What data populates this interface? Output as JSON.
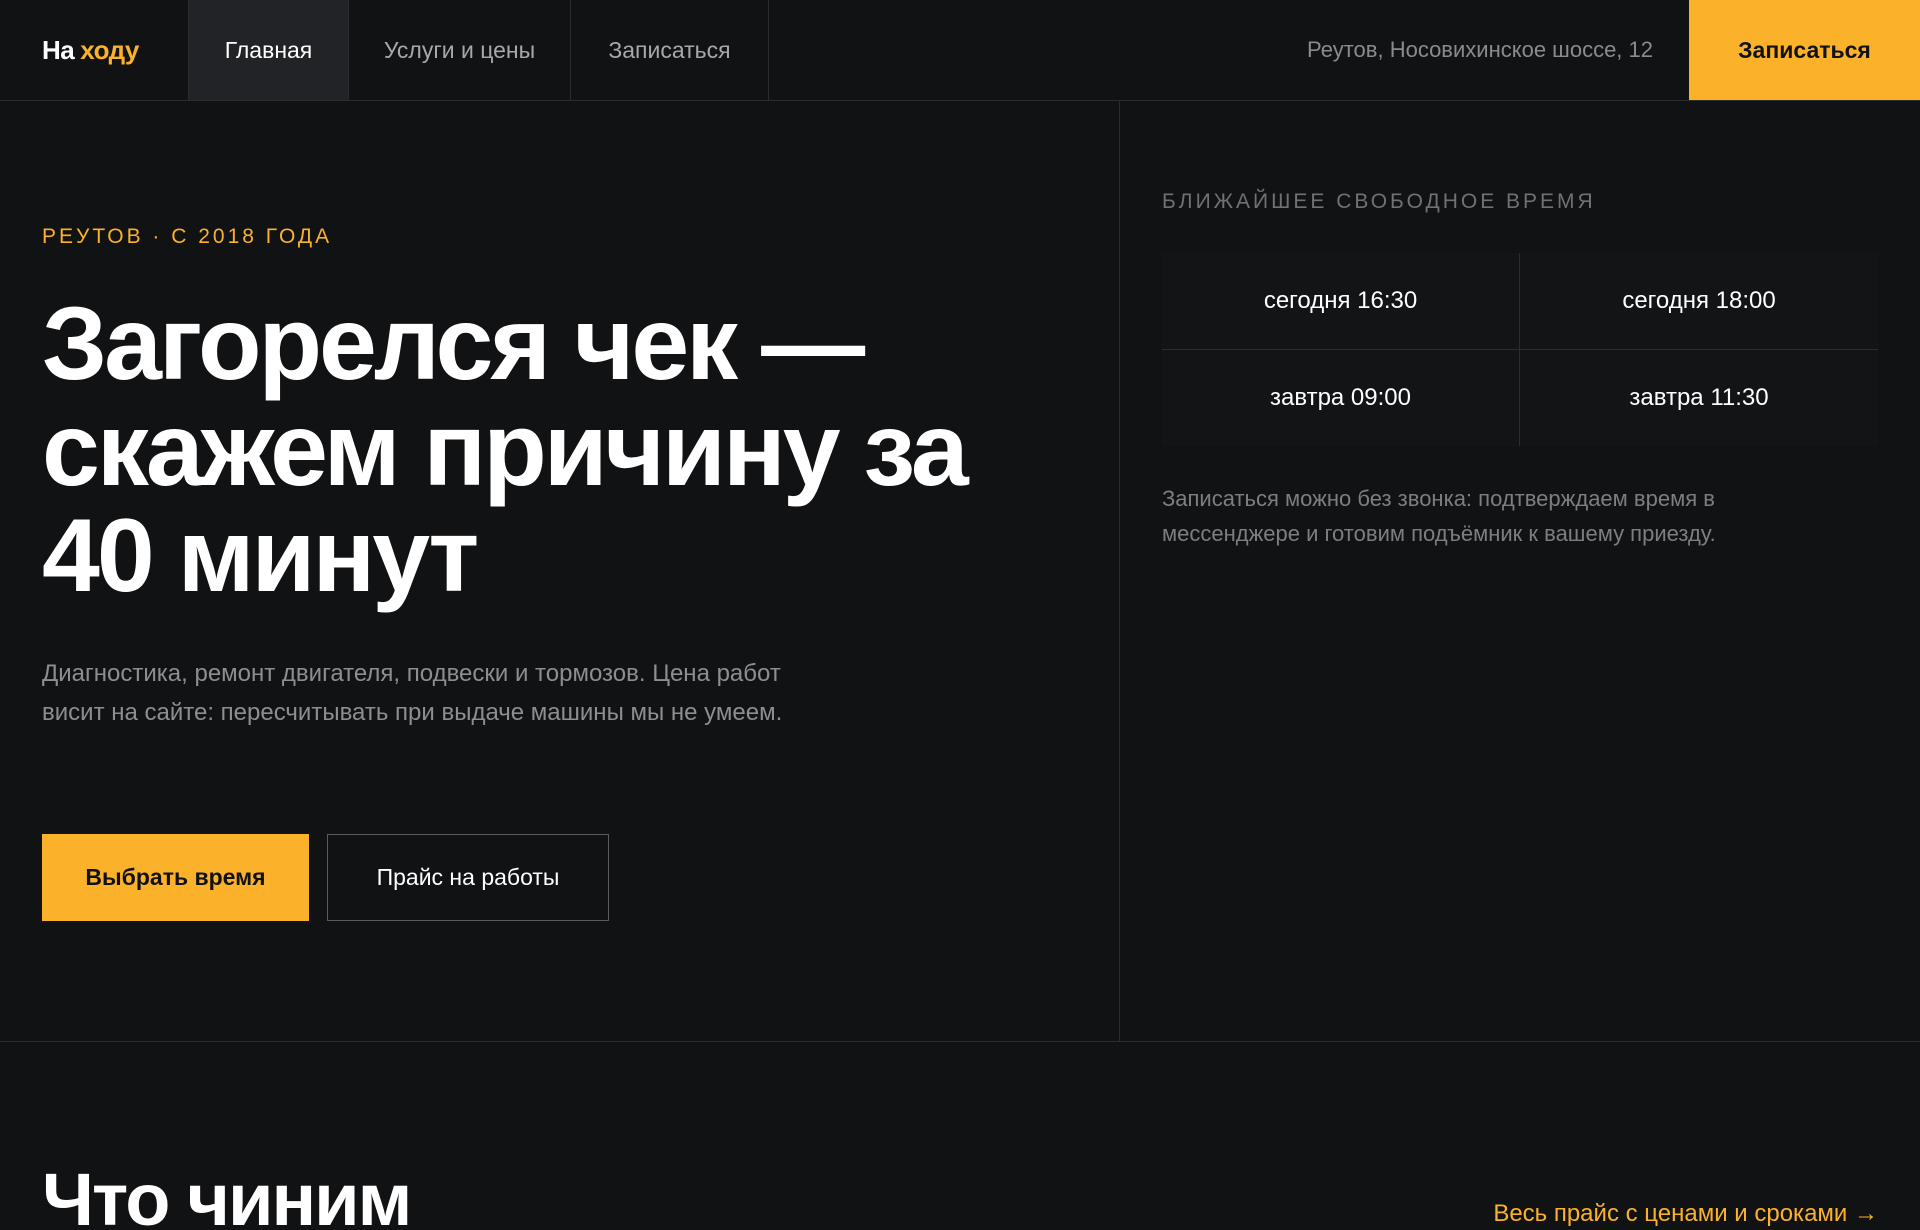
{
  "header": {
    "logo_main": "На",
    "logo_accent": "ходу",
    "nav": [
      "Главная",
      "Услуги и цены",
      "Записаться"
    ],
    "address": "Реутов, Носовихинское шоссе, 12",
    "cta": "Записаться"
  },
  "hero": {
    "eyebrow": "РЕУТОВ · С 2018 ГОДА",
    "headline": "Загорелся чек — скажем причину за 40 минут",
    "lede": "Диагностика, ремонт двигателя, подвески и тормозов. Цена работ висит на сайте: пересчитывать при выдаче машины мы не умеем.",
    "primary_button": "Выбрать время",
    "secondary_button": "Прайс на работы"
  },
  "slots": {
    "title": "БЛИЖАЙШЕЕ СВОБОДНОЕ ВРЕМЯ",
    "items": [
      "сегодня 16:30",
      "сегодня 18:00",
      "завтра 09:00",
      "завтра 11:30"
    ],
    "note": "Записаться можно без звонка: подтверждаем время в мессенджере и готовим подъёмник к вашему приезду."
  },
  "services": {
    "title": "Что чиним",
    "link": "Весь прайс с ценами и сроками →"
  },
  "colors": {
    "accent": "#fbb12a",
    "background": "#111214"
  }
}
